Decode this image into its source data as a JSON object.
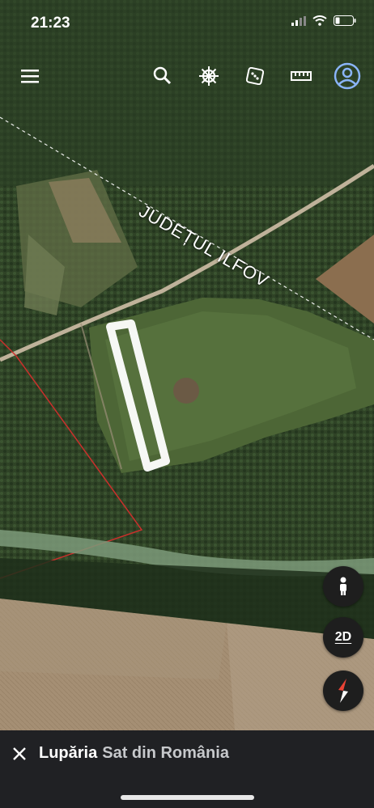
{
  "status_bar": {
    "time": "21:23"
  },
  "toolbar": {
    "icons": [
      "menu-icon",
      "search-icon",
      "ship-wheel-icon",
      "dice-icon",
      "ruler-icon",
      "account-icon"
    ]
  },
  "map": {
    "boundary_label": "JUDEȚUL ILFOV"
  },
  "controls": {
    "view_mode_label": "2D"
  },
  "place": {
    "name": "Lupăria",
    "subtitle": "Sat din România"
  },
  "colors": {
    "sheet_bg": "#202124",
    "accent_blue": "#8ab4f8",
    "compass_red": "#ea4335"
  }
}
